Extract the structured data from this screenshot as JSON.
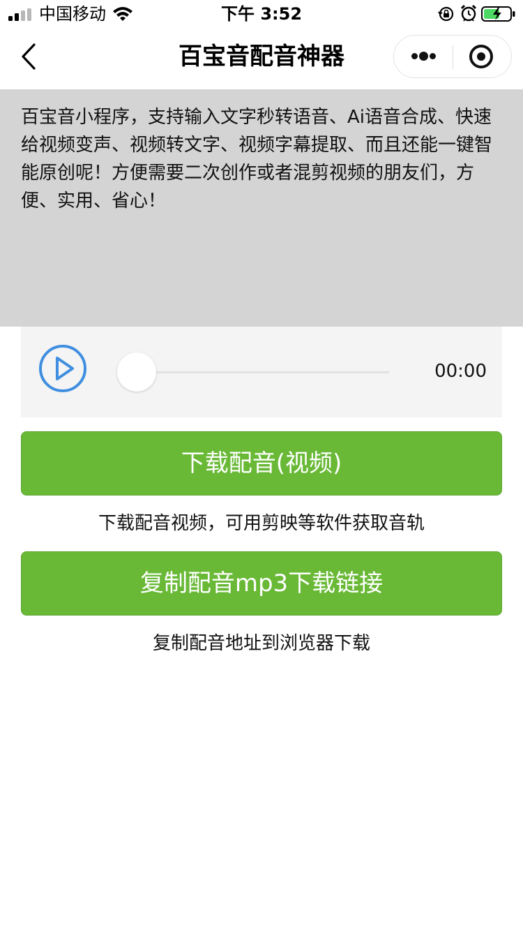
{
  "status_bar": {
    "carrier": "中国移动",
    "time": "下午 3:52",
    "battery_color": "#4cd964"
  },
  "nav": {
    "title": "百宝音配音神器"
  },
  "text_area": {
    "content": "百宝音小程序，支持输入文字秒转语音、Ai语音合成、快速给视频变声、视频转文字、视频字幕提取、而且还能一键智能原创呢！方便需要二次创作或者混剪视频的朋友们，方便、实用、省心！"
  },
  "audio_player": {
    "current_time": "00:00",
    "progress": 0.0,
    "accent_color": "#3f8ee0"
  },
  "actions": {
    "download_label": "下载配音(视频)",
    "download_hint": "下载配音视频，可用剪映等软件获取音轨",
    "copy_label": "复制配音mp3下载链接",
    "copy_hint": "复制配音地址到浏览器下载",
    "button_color": "#69b937"
  }
}
